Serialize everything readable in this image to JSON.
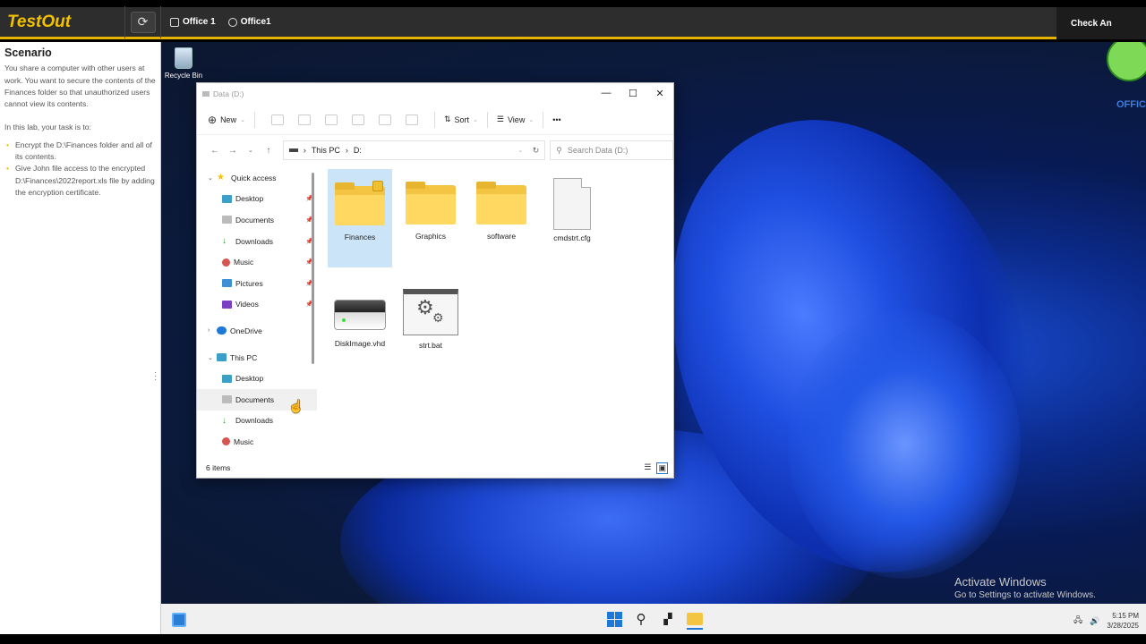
{
  "topbar": {
    "logo": "TestOut",
    "tabs": [
      {
        "label": "Office 1"
      },
      {
        "label": "Office1"
      }
    ],
    "check_button": "Check An"
  },
  "scenario": {
    "title": "Scenario",
    "intro": "You share a computer with other users at work. You want to secure the contents of the Finances folder so that unauthorized users cannot view its contents.",
    "task_lead": "In this lab, your task is to:",
    "tasks": [
      "Encrypt the D:\\Finances folder and all of its contents.",
      "Give John file access to the encrypted D:\\Finances\\2022report.xls file by adding the encryption certificate."
    ]
  },
  "desktop": {
    "recycle_bin": "Recycle Bin",
    "watermark_title": "Activate Windows",
    "watermark_sub": "Go to Settings to activate Windows.",
    "corner_logo": "OFFIC"
  },
  "explorer": {
    "title": "Data (D:)",
    "cmdbar": {
      "new": "New",
      "sort": "Sort",
      "view": "View",
      "more": "•••"
    },
    "address": {
      "pc": "This PC",
      "drive": "D:"
    },
    "search_placeholder": "Search Data (D:)",
    "nav": {
      "quick_access": "Quick access",
      "quick_items": [
        "Desktop",
        "Documents",
        "Downloads",
        "Music",
        "Pictures",
        "Videos"
      ],
      "onedrive": "OneDrive",
      "this_pc": "This PC",
      "pc_items": [
        "Desktop",
        "Documents",
        "Downloads",
        "Music"
      ]
    },
    "files": [
      {
        "name": "Finances"
      },
      {
        "name": "Graphics"
      },
      {
        "name": "software"
      },
      {
        "name": "cmdstrt.cfg"
      },
      {
        "name": "DiskImage.vhd"
      },
      {
        "name": "strt.bat"
      }
    ],
    "status": "6 items"
  },
  "taskbar": {
    "time": "5:15 PM",
    "date": "3/28/2025"
  }
}
